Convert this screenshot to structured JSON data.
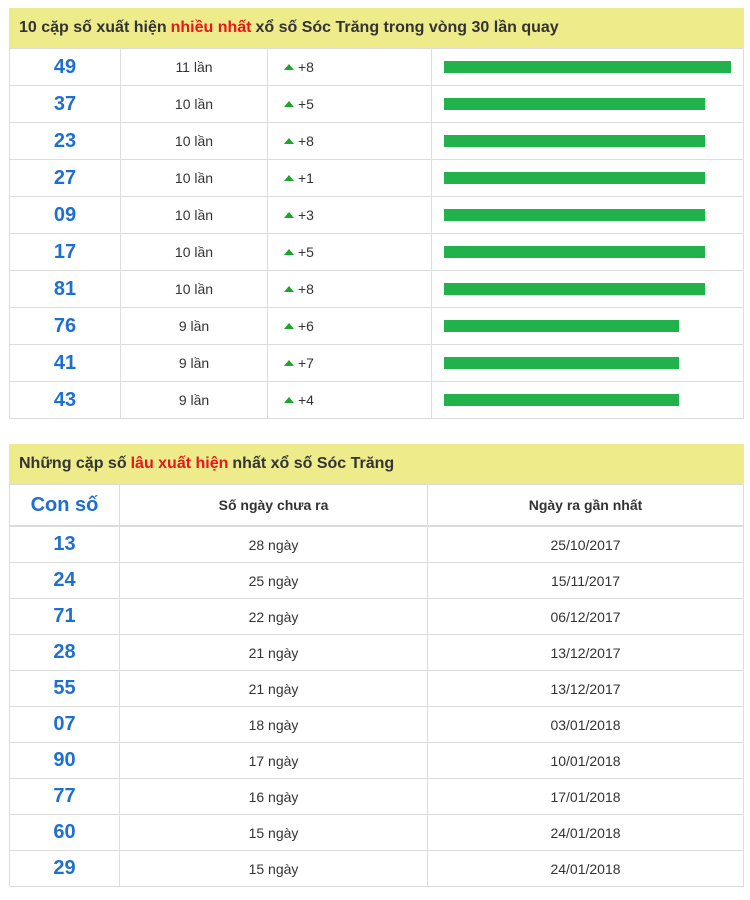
{
  "top": {
    "title_prefix": "10 cặp số xuất hiện",
    "title_highlight": "nhiều nhất",
    "title_suffix": "xổ số Sóc Trăng trong vòng 30 lần quay",
    "rows": [
      {
        "number": "49",
        "times": "11 lần",
        "delta": "+8",
        "bar_fraction": 1.0
      },
      {
        "number": "37",
        "times": "10 lần",
        "delta": "+5",
        "bar_fraction": 0.909
      },
      {
        "number": "23",
        "times": "10 lần",
        "delta": "+8",
        "bar_fraction": 0.909
      },
      {
        "number": "27",
        "times": "10 lần",
        "delta": "+1",
        "bar_fraction": 0.909
      },
      {
        "number": "09",
        "times": "10 lần",
        "delta": "+3",
        "bar_fraction": 0.909
      },
      {
        "number": "17",
        "times": "10 lần",
        "delta": "+5",
        "bar_fraction": 0.909
      },
      {
        "number": "81",
        "times": "10 lần",
        "delta": "+8",
        "bar_fraction": 0.909
      },
      {
        "number": "76",
        "times": "9 lần",
        "delta": "+6",
        "bar_fraction": 0.818
      },
      {
        "number": "41",
        "times": "9 lần",
        "delta": "+7",
        "bar_fraction": 0.818
      },
      {
        "number": "43",
        "times": "9 lần",
        "delta": "+4",
        "bar_fraction": 0.818
      }
    ]
  },
  "bottom": {
    "title_prefix": "Những cặp số",
    "title_highlight": "lâu xuất hiện",
    "title_suffix": "nhất xổ số Sóc Trăng",
    "columns": {
      "number": "Con số",
      "days": "Số ngày chưa ra",
      "last": "Ngày ra gần nhất"
    },
    "rows": [
      {
        "number": "13",
        "days": "28 ngày",
        "last": "25/10/2017"
      },
      {
        "number": "24",
        "days": "25 ngày",
        "last": "15/11/2017"
      },
      {
        "number": "71",
        "days": "22 ngày",
        "last": "06/12/2017"
      },
      {
        "number": "28",
        "days": "21 ngày",
        "last": "13/12/2017"
      },
      {
        "number": "55",
        "days": "21 ngày",
        "last": "13/12/2017"
      },
      {
        "number": "07",
        "days": "18 ngày",
        "last": "03/01/2018"
      },
      {
        "number": "90",
        "days": "17 ngày",
        "last": "10/01/2018"
      },
      {
        "number": "77",
        "days": "16 ngày",
        "last": "17/01/2018"
      },
      {
        "number": "60",
        "days": "15 ngày",
        "last": "24/01/2018"
      },
      {
        "number": "29",
        "days": "15 ngày",
        "last": "24/01/2018"
      }
    ]
  },
  "colors": {
    "header_bg": "#eeeb8a",
    "highlight": "#e8171b",
    "number": "#1f6fd1",
    "bar": "#21b24b",
    "up_arrow": "#1aa52b"
  }
}
